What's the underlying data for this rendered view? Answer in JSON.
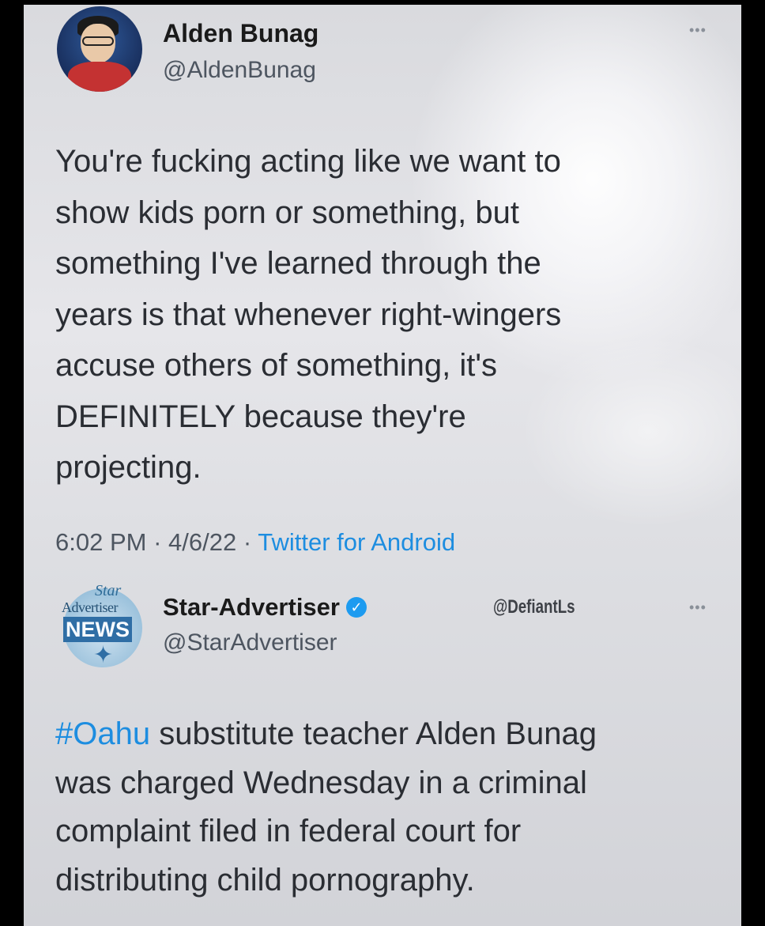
{
  "tweet1": {
    "author_name": "Alden Bunag",
    "author_handle": "@AldenBunag",
    "more_icon": "more-options-icon",
    "text_lines": [
      "You're fucking acting like we want to",
      "show kids porn or something, but",
      "something I've learned through the",
      "years is that whenever right-wingers",
      "accuse others of something, it's",
      "DEFINITELY because they're",
      "projecting."
    ],
    "time": "6:02 PM",
    "date": "4/6/22",
    "separator": "·",
    "source": "Twitter for Android"
  },
  "tweet2": {
    "logo_line1": "Star",
    "logo_line2": "Advertiser",
    "logo_line3": "NEWS",
    "author_name": "Star-Advertiser",
    "verified_icon": "verified-badge-icon",
    "author_handle": "@StarAdvertiser",
    "watermark": "@DefiantLs",
    "more_icon": "more-options-icon",
    "hashtag": "#Oahu",
    "text_first_rest": " substitute teacher Alden Bunag",
    "text_lines": [
      "was charged Wednesday in a criminal",
      "complaint filed in federal court for",
      "distributing child pornography."
    ]
  },
  "colors": {
    "link_blue": "#1d8de0",
    "verified_blue": "#1d9bf0",
    "text_dark": "#2a2d33",
    "text_muted": "#4d5560"
  }
}
